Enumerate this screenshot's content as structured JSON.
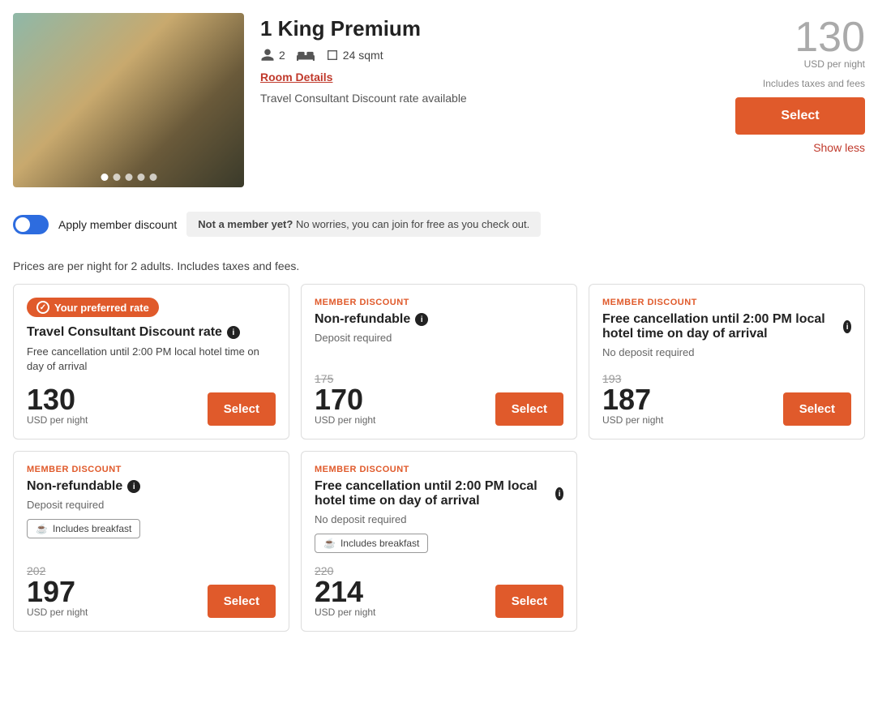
{
  "room": {
    "title": "1 King Premium",
    "guests": "2",
    "size": "24 sqmt",
    "details_link": "Room Details",
    "discount_text": "Travel Consultant Discount rate available",
    "price_header": "130",
    "price_per_night": "USD per night",
    "includes_taxes": "Includes taxes and fees",
    "select_label": "Select",
    "show_less": "Show less",
    "image_dots": 5
  },
  "toggle_section": {
    "label": "Apply member discount",
    "notice_bold": "Not a member yet?",
    "notice_text": " No worries, you can join for free as you check out."
  },
  "pricing_note": "Prices are per night for 2 adults. Includes taxes and fees.",
  "rate_cards": [
    {
      "preferred": true,
      "preferred_label": "Your preferred rate",
      "member_discount": false,
      "title": "Travel Consultant Discount rate",
      "has_info": true,
      "cancellation": "Free cancellation until 2:00 PM local hotel time on day of arrival",
      "deposit": "",
      "breakfast": false,
      "original_price": "",
      "current_price": "130",
      "per_night": "USD per night",
      "select": "Select"
    },
    {
      "preferred": false,
      "member_discount": true,
      "member_label": "MEMBER DISCOUNT",
      "title": "Non-refundable",
      "has_info": true,
      "cancellation": "",
      "deposit": "Deposit required",
      "breakfast": false,
      "original_price": "175",
      "current_price": "170",
      "per_night": "USD per night",
      "select": "Select"
    },
    {
      "preferred": false,
      "member_discount": true,
      "member_label": "MEMBER DISCOUNT",
      "title": "Free cancellation until 2:00 PM local hotel time on day of arrival",
      "has_info": true,
      "cancellation": "",
      "deposit": "No deposit required",
      "breakfast": false,
      "original_price": "193",
      "current_price": "187",
      "per_night": "USD per night",
      "select": "Select"
    },
    {
      "preferred": false,
      "member_discount": true,
      "member_label": "MEMBER DISCOUNT",
      "title": "Non-refundable",
      "has_info": true,
      "cancellation": "",
      "deposit": "Deposit required",
      "breakfast": true,
      "breakfast_label": "Includes breakfast",
      "original_price": "202",
      "current_price": "197",
      "per_night": "USD per night",
      "select": "Select"
    },
    {
      "preferred": false,
      "member_discount": true,
      "member_label": "MEMBER DISCOUNT",
      "title": "Free cancellation until 2:00 PM local hotel time on day of arrival",
      "has_info": true,
      "cancellation": "",
      "deposit": "No deposit required",
      "breakfast": true,
      "breakfast_label": "Includes breakfast",
      "original_price": "220",
      "current_price": "214",
      "per_night": "USD per night",
      "select": "Select"
    },
    {
      "empty": true
    }
  ]
}
